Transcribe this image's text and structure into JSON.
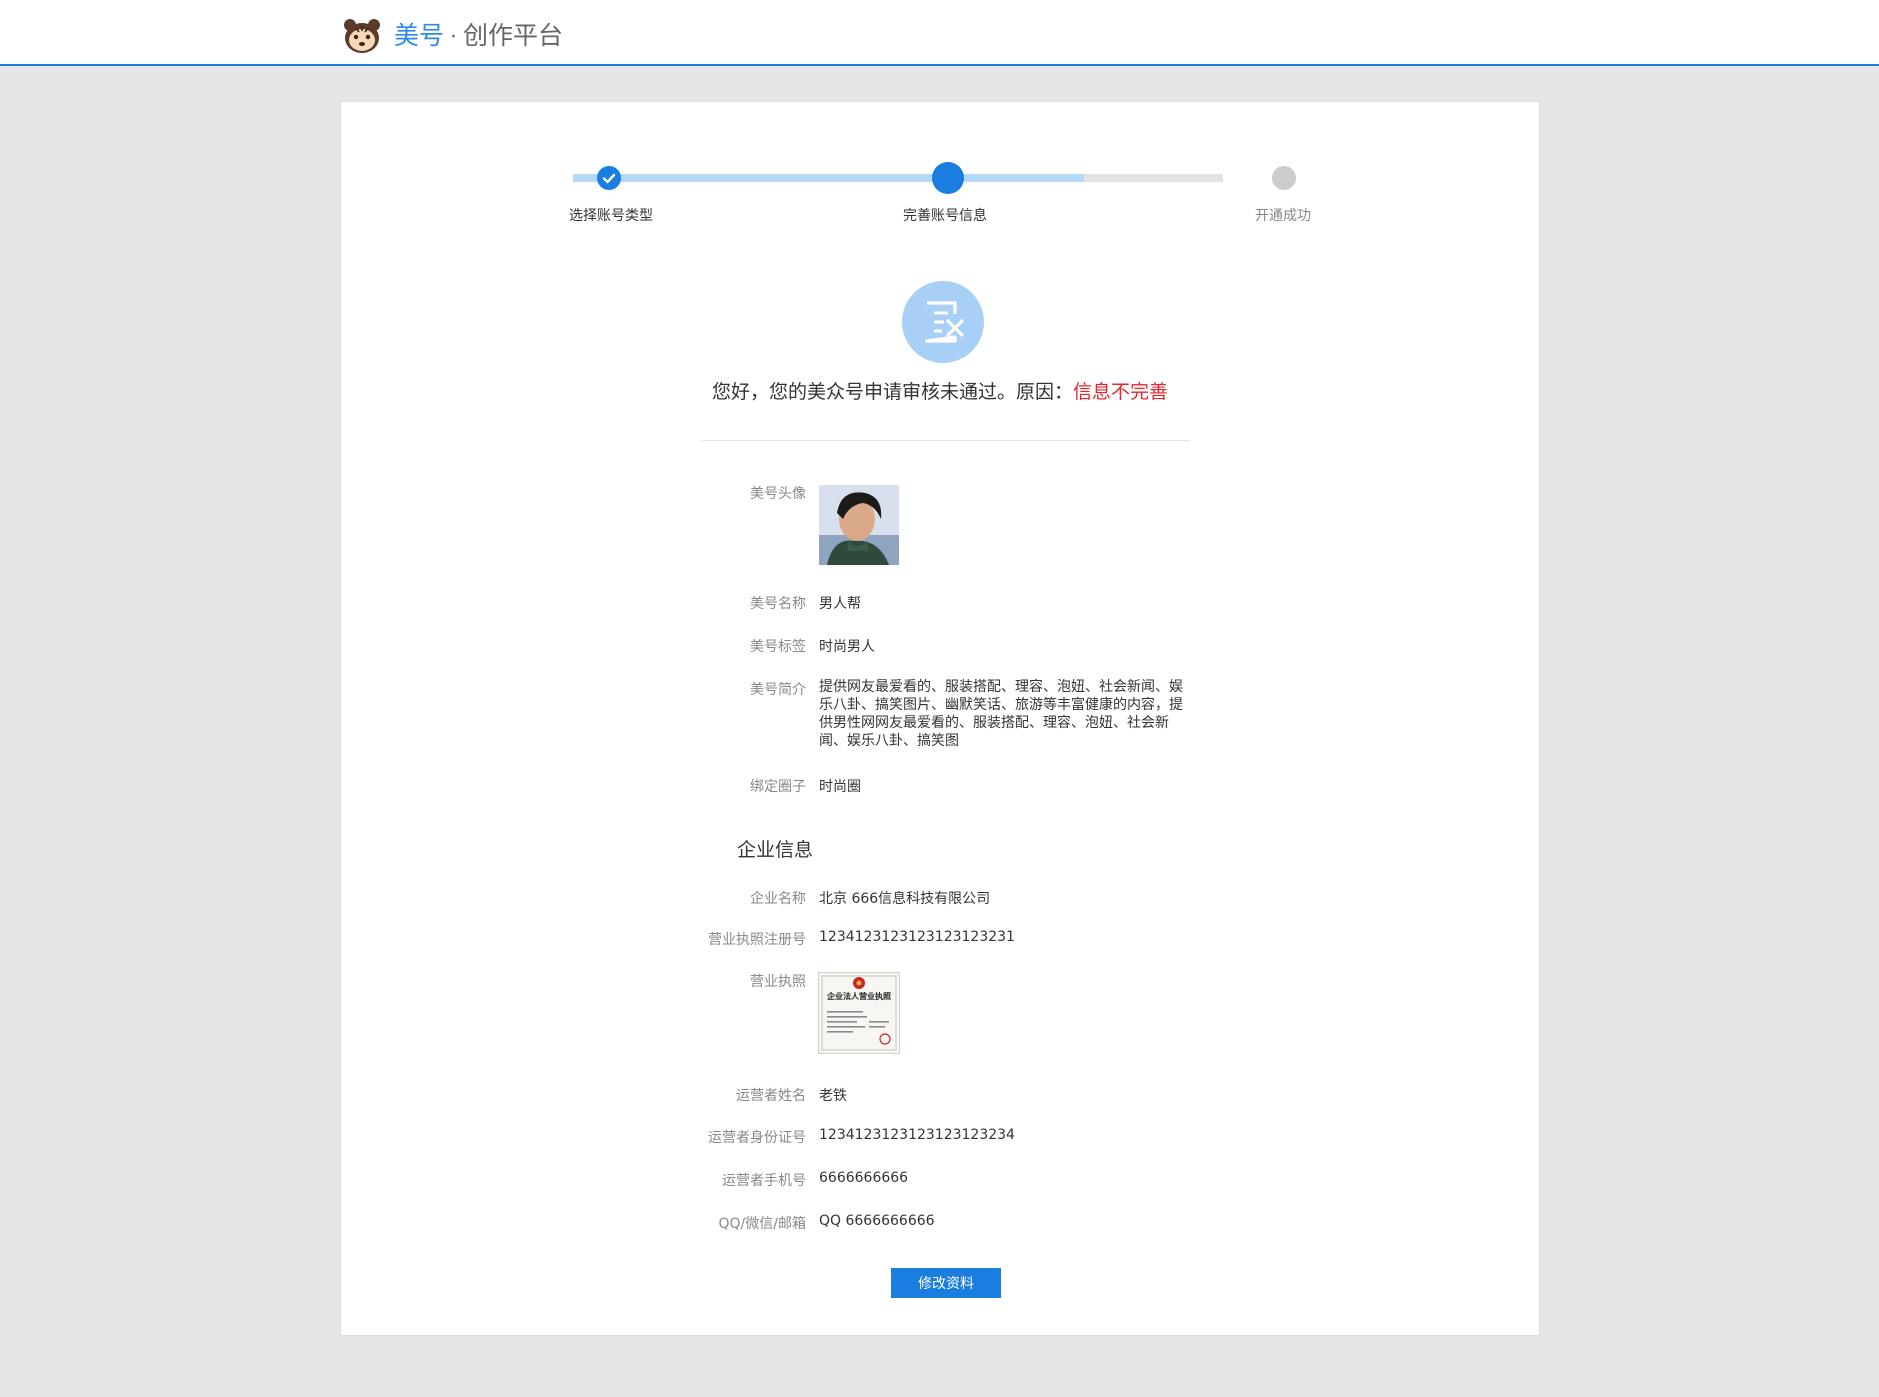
{
  "header": {
    "brand_name": "美号",
    "separator": "·",
    "platform_name": "创作平台"
  },
  "steps": [
    {
      "label": "选择账号类型",
      "state": "done"
    },
    {
      "label": "完善账号信息",
      "state": "current"
    },
    {
      "label": "开通成功",
      "state": "pending"
    }
  ],
  "status": {
    "icon": "form-reject-icon",
    "message": "您好，您的美众号申请审核未通过。原因：",
    "reason": "信息不完善"
  },
  "profile": {
    "avatar_label": "美号头像",
    "name_label": "美号名称",
    "name_value": "男人帮",
    "tag_label": "美号标签",
    "tag_value": "时尚男人",
    "intro_label": "美号简介",
    "intro_value": "提供网友最爱看的、服装搭配、理容、泡妞、社会新闻、娱乐八卦、搞笑图片、幽默笑话、旅游等丰富健康的内容，提供男性网网友最爱看的、服装搭配、理容、泡妞、社会新闻、娱乐八卦、搞笑图",
    "circle_label": "绑定圈子",
    "circle_value": "时尚圈"
  },
  "company": {
    "section_title": "企业信息",
    "name_label": "企业名称",
    "name_value": "北京 666信息科技有限公司",
    "reg_label": "营业执照注册号",
    "reg_value": "1234123123123123123231",
    "license_label": "营业执照",
    "license_title": "企业法人营业执照",
    "operator_label": "运营者姓名",
    "operator_value": "老铁",
    "id_label": "运营者身份证号",
    "id_value": "1234123123123123123234",
    "phone_label": "运营者手机号",
    "phone_value": "6666666666",
    "contact_label": "QQ/微信/邮箱",
    "contact_value": "QQ 6666666666"
  },
  "actions": {
    "edit_label": "修改资料"
  },
  "colors": {
    "accent": "#1a7de0",
    "reason": "#e8252f",
    "step_done_track": "#b4d8f7",
    "step_pending": "#cccccc"
  }
}
